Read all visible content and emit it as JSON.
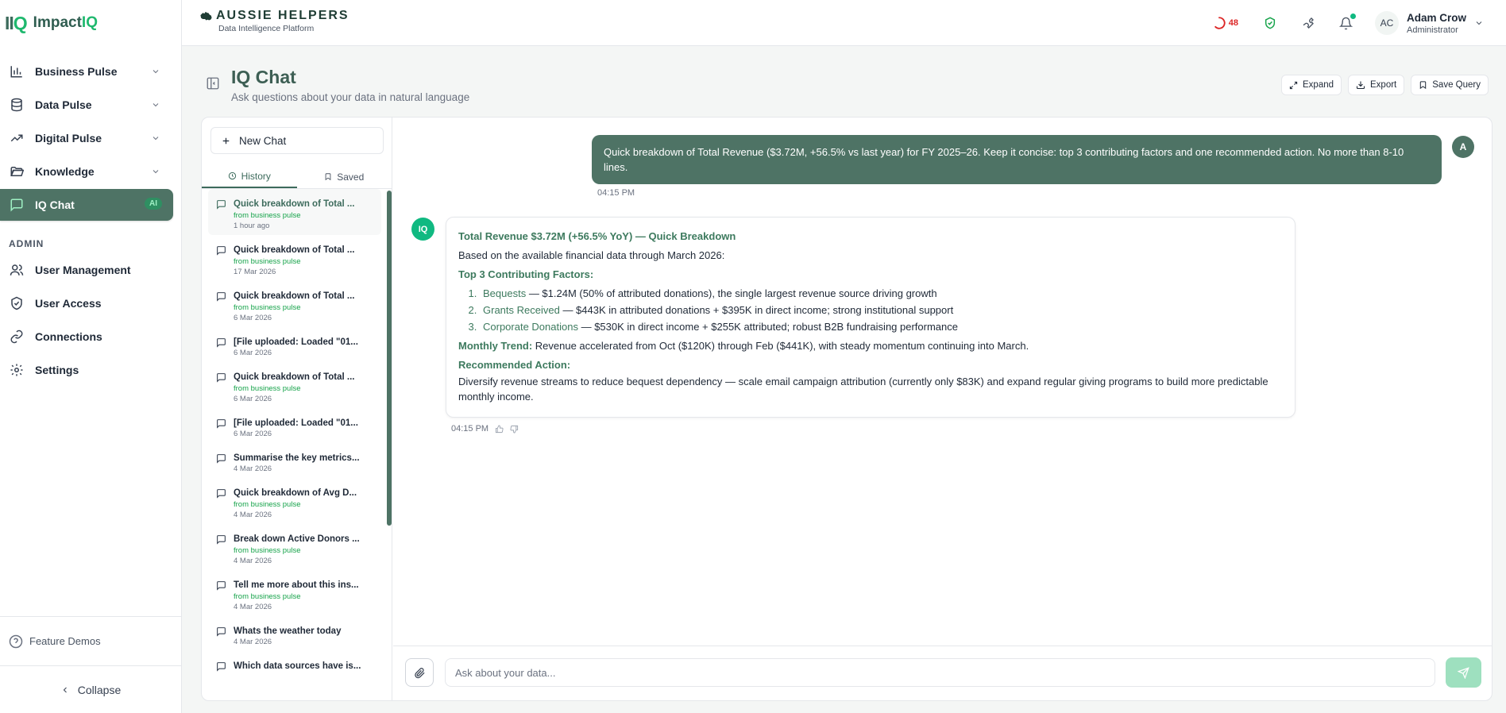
{
  "brand": {
    "mark": "II",
    "mark_q": "Q",
    "name": "Impact",
    "name_q": "IQ"
  },
  "sidebar": {
    "items": [
      {
        "label": "Business Pulse"
      },
      {
        "label": "Data Pulse"
      },
      {
        "label": "Digital Pulse"
      },
      {
        "label": "Knowledge"
      },
      {
        "label": "IQ Chat",
        "badge": "AI"
      }
    ],
    "admin_label": "ADMIN",
    "admin_items": [
      {
        "label": "User Management"
      },
      {
        "label": "User Access"
      },
      {
        "label": "Connections"
      },
      {
        "label": "Settings"
      }
    ],
    "feature_demos": "Feature Demos",
    "collapse": "Collapse"
  },
  "topbar": {
    "org_name": "AUSSIE HELPERS",
    "org_sub": "Data Intelligence Platform",
    "spin_count": "48",
    "user_initials": "AC",
    "user_name": "Adam Crow",
    "user_role": "Administrator"
  },
  "page": {
    "title": "IQ Chat",
    "subtitle": "Ask questions about your data in natural language",
    "actions": {
      "expand": "Expand",
      "export": "Export",
      "save_query": "Save Query"
    }
  },
  "history": {
    "new_chat": "New Chat",
    "tabs": {
      "history": "History",
      "saved": "Saved"
    },
    "items": [
      {
        "title": "Quick breakdown of Total ...",
        "source": "from business pulse",
        "date": "1 hour ago"
      },
      {
        "title": "Quick breakdown of Total ...",
        "source": "from business pulse",
        "date": "17 Mar 2026"
      },
      {
        "title": "Quick breakdown of Total ...",
        "source": "from business pulse",
        "date": "6 Mar 2026"
      },
      {
        "title": "[File uploaded: Loaded \"01...",
        "source": "",
        "date": "6 Mar 2026"
      },
      {
        "title": "Quick breakdown of Total ...",
        "source": "from business pulse",
        "date": "6 Mar 2026"
      },
      {
        "title": "[File uploaded: Loaded \"01...",
        "source": "",
        "date": "6 Mar 2026"
      },
      {
        "title": "Summarise the key metrics...",
        "source": "",
        "date": "4 Mar 2026"
      },
      {
        "title": "Quick breakdown of Avg D...",
        "source": "from business pulse",
        "date": "4 Mar 2026"
      },
      {
        "title": "Break down Active Donors ...",
        "source": "from business pulse",
        "date": "4 Mar 2026"
      },
      {
        "title": "Tell me more about this ins...",
        "source": "from business pulse",
        "date": "4 Mar 2026"
      },
      {
        "title": "Whats the weather today",
        "source": "",
        "date": "4 Mar 2026"
      },
      {
        "title": "Which data sources have is...",
        "source": "",
        "date": ""
      }
    ]
  },
  "thread": {
    "user_avatar": "A",
    "user_message": "Quick breakdown of Total Revenue ($3.72M, +56.5% vs last year) for FY 2025–26. Keep it concise: top 3 contributing factors and one recommended action. No more than 8-10 lines.",
    "user_time": "04:15 PM",
    "bot_avatar": "IQ",
    "bot_heading": "Total Revenue $3.72M (+56.5% YoY) — Quick Breakdown",
    "bot_intro": "Based on the available financial data through March 2026:",
    "factors_heading": "Top 3 Contributing Factors:",
    "factors": [
      {
        "name": "Bequests",
        "detail": " — $1.24M (50% of attributed donations), the single largest revenue source driving growth"
      },
      {
        "name": "Grants Received",
        "detail": " — $443K in attributed donations + $395K in direct income; strong institutional support"
      },
      {
        "name": "Corporate Donations",
        "detail": " — $530K in direct income + $255K attributed; robust B2B fundraising performance"
      }
    ],
    "trend_label": "Monthly Trend:",
    "trend_text": " Revenue accelerated from Oct ($120K) through Feb ($441K), with steady momentum continuing into March.",
    "action_label": "Recommended Action:",
    "action_text": "Diversify revenue streams to reduce bequest dependency — scale email campaign attribution (currently only $83K) and expand regular giving programs to build more predictable monthly income.",
    "bot_time": "04:15 PM"
  },
  "composer": {
    "placeholder": "Ask about your data..."
  },
  "colors": {
    "accent": "#4e7365",
    "brand_green": "#1fb86e",
    "alert": "#dc2626"
  }
}
